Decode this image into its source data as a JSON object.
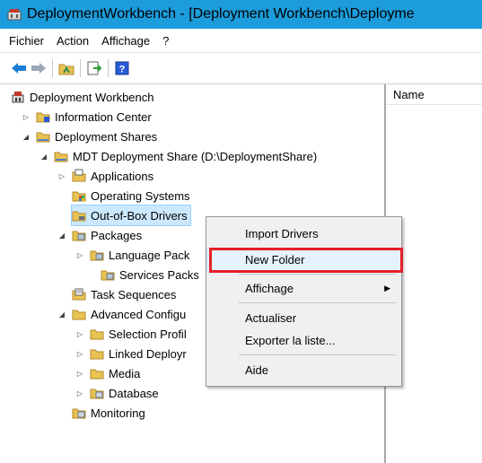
{
  "window": {
    "title": "DeploymentWorkbench - [Deployment Workbench\\Deployme"
  },
  "menu": [
    "Fichier",
    "Action",
    "Affichage",
    "?"
  ],
  "toolbar": {
    "icons": [
      "back-arrow-icon",
      "forward-arrow-icon",
      "up-folder-icon",
      "export-icon",
      "help-icon"
    ]
  },
  "tree": {
    "root": "Deployment Workbench",
    "information_center": "Information Center",
    "deployment_shares": "Deployment Shares",
    "share": "MDT Deployment Share (D:\\DeploymentShare)",
    "applications": "Applications",
    "operating_systems": "Operating Systems",
    "oob_drivers": "Out-of-Box Drivers",
    "packages": "Packages",
    "language_packs": "Language Pack",
    "services_packs": "Services Packs",
    "task_sequences": "Task Sequences",
    "advanced_config": "Advanced Configu",
    "selection_profiles": "Selection Profil",
    "linked_deployment": "Linked Deployr",
    "media": "Media",
    "database": "Database",
    "monitoring": "Monitoring"
  },
  "list": {
    "column_name": "Name"
  },
  "context_menu": {
    "import_drivers": "Import Drivers",
    "new_folder": "New Folder",
    "affichage": "Affichage",
    "actualiser": "Actualiser",
    "exporter": "Exporter la liste...",
    "aide": "Aide"
  },
  "colors": {
    "titlebar": "#1c9cdb",
    "highlight_box": "#e32026",
    "selection": "#cce8ff"
  }
}
